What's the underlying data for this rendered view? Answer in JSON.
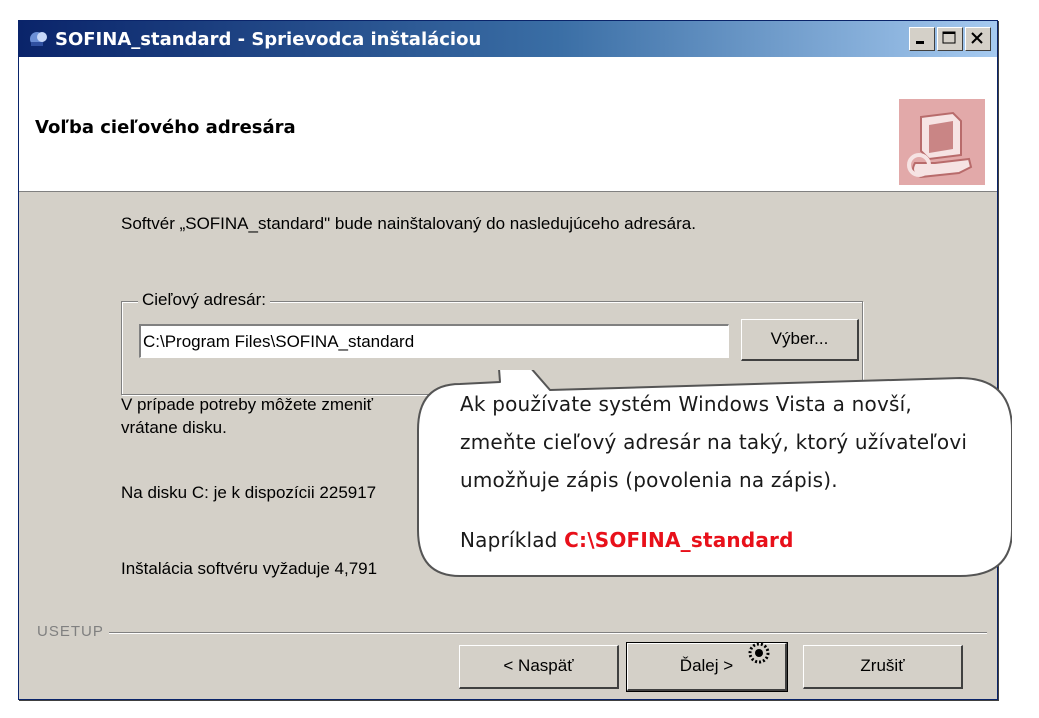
{
  "window": {
    "title": "SOFINA_standard - Sprievodca inštaláciou"
  },
  "header": {
    "title": "Voľba cieľového adresára"
  },
  "body": {
    "intro": "Softvér „SOFINA_standard\" bude nainštalovaný do nasledujúceho adresára.",
    "group_label": "Cieľový adresár:",
    "path_value": "C:\\Program Files\\SOFINA_standard",
    "browse_label": "Výber...",
    "change_hint_line1": "V prípade potreby môžete zmeniť",
    "change_hint_line2": "vrátane disku.",
    "disk_space": "Na disku C: je k dispozícii 225917",
    "requires": "Inštalácia softvéru vyžaduje 4,791"
  },
  "footer": {
    "brand": "USETUP",
    "back_label": "< Naspäť",
    "next_label": "Ďalej >",
    "cancel_label": "Zrušiť"
  },
  "callout": {
    "line1": "Ak používate systém Windows Vista a novší,",
    "line2": "zmeňte cieľový adresár na taký, ktorý užívateľovi",
    "line3": "umožňuje zápis (povolenia na zápis).",
    "example_prefix": "Napríklad ",
    "example_path": "C:\\SOFINA_standard"
  }
}
